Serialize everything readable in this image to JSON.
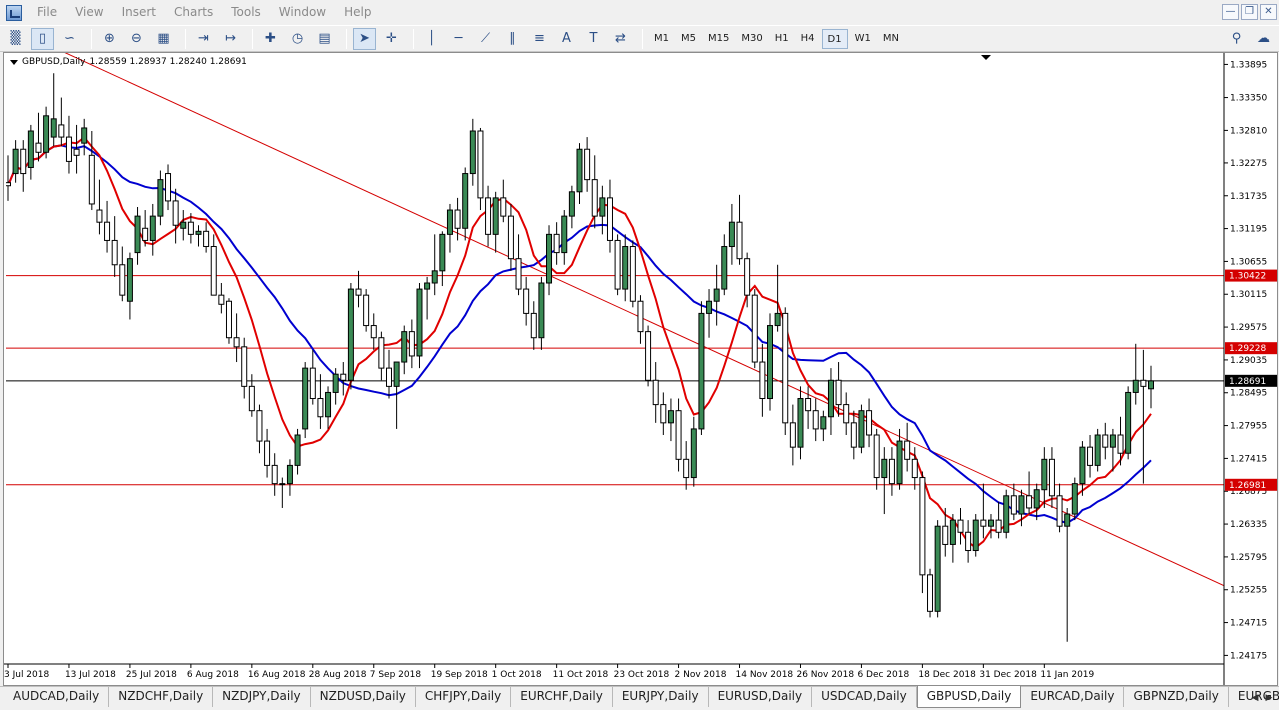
{
  "menu": {
    "items": [
      "File",
      "View",
      "Insert",
      "Charts",
      "Tools",
      "Window",
      "Help"
    ]
  },
  "window_controls": [
    "minimize",
    "restore",
    "close"
  ],
  "toolbar": {
    "icons": [
      "new-chart-icon",
      "bar-chart-icon",
      "candlestick-icon",
      "line-chart-icon",
      "zoom-in-icon",
      "zoom-out-icon",
      "tile-windows-icon",
      "chart-shift-icon",
      "autoscroll-icon",
      "indicators-icon",
      "periods-icon",
      "templates-icon",
      "cursor-icon",
      "crosshair-icon",
      "vertical-line-icon",
      "horizontal-line-icon",
      "trendline-icon",
      "equidistant-channel-icon",
      "fibonacci-icon",
      "text-icon",
      "text-label-icon",
      "arrows-icon",
      "search-icon",
      "community-icon"
    ],
    "timeframes": [
      "M1",
      "M5",
      "M15",
      "M30",
      "H1",
      "H4",
      "D1",
      "W1",
      "MN"
    ],
    "active_timeframe": "D1"
  },
  "chart": {
    "symbol_label": "GBPUSD,Daily",
    "ohlc": "1.28559 1.28937 1.28240 1.28691",
    "colors": {
      "bull": "#3a8a55",
      "bear": "#ffffff",
      "wick": "#000000",
      "ma_fast": "#e00000",
      "ma_slow": "#0000d0",
      "hline": "#d40000",
      "current_price_line": "#000000",
      "trendline": "#d40000"
    }
  },
  "chart_data": {
    "type": "candlestick",
    "symbol": "GBPUSD",
    "timeframe": "Daily",
    "y_ticks": [
      "1.33895",
      "1.33350",
      "1.32810",
      "1.32275",
      "1.31735",
      "1.31195",
      "1.30655",
      "1.30115",
      "1.29575",
      "1.29035",
      "1.28495",
      "1.27955",
      "1.27415",
      "1.26875",
      "1.26335",
      "1.25795",
      "1.25255",
      "1.24715",
      "1.24175"
    ],
    "ylim": [
      1.2405,
      1.3405
    ],
    "x_ticks": [
      "3 Jul 2018",
      "13 Jul 2018",
      "25 Jul 2018",
      "6 Aug 2018",
      "16 Aug 2018",
      "28 Aug 2018",
      "7 Sep 2018",
      "19 Sep 2018",
      "1 Oct 2018",
      "11 Oct 2018",
      "23 Oct 2018",
      "2 Nov 2018",
      "14 Nov 2018",
      "26 Nov 2018",
      "6 Dec 2018",
      "18 Dec 2018",
      "31 Dec 2018",
      "11 Jan 2019"
    ],
    "price_labels": [
      {
        "value": 1.30422,
        "text": "1.30422",
        "style": "red"
      },
      {
        "value": 1.29228,
        "text": "1.29228",
        "style": "red"
      },
      {
        "value": 1.28691,
        "text": "1.28691",
        "style": "black"
      },
      {
        "value": 1.26981,
        "text": "1.26981",
        "style": "red"
      }
    ],
    "horizontal_lines": [
      1.30422,
      1.29228,
      1.26981
    ],
    "current_price": 1.28691,
    "trendline": [
      {
        "bar": 0,
        "price": 1.3452
      },
      {
        "bar": 140,
        "price": 1.2645
      }
    ],
    "bars": [
      [
        1.3195,
        1.324,
        1.3165,
        1.319
      ],
      [
        1.321,
        1.3265,
        1.3195,
        1.325
      ],
      [
        1.325,
        1.3265,
        1.318,
        1.321
      ],
      [
        1.322,
        1.329,
        1.32,
        1.328
      ],
      [
        1.326,
        1.331,
        1.323,
        1.3245
      ],
      [
        1.3245,
        1.332,
        1.3235,
        1.3305
      ],
      [
        1.327,
        1.3375,
        1.3255,
        1.33
      ],
      [
        1.329,
        1.3335,
        1.3255,
        1.327
      ],
      [
        1.327,
        1.3305,
        1.321,
        1.323
      ],
      [
        1.325,
        1.329,
        1.321,
        1.324
      ],
      [
        1.326,
        1.33,
        1.324,
        1.3285
      ],
      [
        1.324,
        1.328,
        1.315,
        1.316
      ],
      [
        1.315,
        1.32,
        1.311,
        1.313
      ],
      [
        1.313,
        1.3165,
        1.308,
        1.31
      ],
      [
        1.31,
        1.314,
        1.304,
        1.306
      ],
      [
        1.306,
        1.309,
        1.3,
        1.301
      ],
      [
        1.3,
        1.308,
        1.297,
        1.307
      ],
      [
        1.308,
        1.3155,
        1.306,
        1.314
      ],
      [
        1.312,
        1.315,
        1.309,
        1.31
      ],
      [
        1.31,
        1.316,
        1.3075,
        1.314
      ],
      [
        1.314,
        1.3215,
        1.3125,
        1.32
      ],
      [
        1.321,
        1.3225,
        1.315,
        1.3165
      ],
      [
        1.3165,
        1.3185,
        1.3095,
        1.3125
      ],
      [
        1.312,
        1.315,
        1.31,
        1.313
      ],
      [
        1.313,
        1.3145,
        1.3095,
        1.311
      ],
      [
        1.311,
        1.3125,
        1.309,
        1.3115
      ],
      [
        1.3115,
        1.313,
        1.308,
        1.309
      ],
      [
        1.309,
        1.311,
        1.301,
        1.301
      ],
      [
        1.301,
        1.303,
        1.298,
        1.2995
      ],
      [
        1.3,
        1.3005,
        1.293,
        1.294
      ],
      [
        1.294,
        1.298,
        1.29,
        1.2925
      ],
      [
        1.2925,
        1.294,
        1.284,
        1.286
      ],
      [
        1.286,
        1.288,
        1.281,
        1.282
      ],
      [
        1.282,
        1.283,
        1.275,
        1.277
      ],
      [
        1.277,
        1.279,
        1.271,
        1.273
      ],
      [
        1.273,
        1.275,
        1.268,
        1.27
      ],
      [
        1.27,
        1.271,
        1.266,
        1.27
      ],
      [
        1.27,
        1.274,
        1.268,
        1.273
      ],
      [
        1.273,
        1.279,
        1.2715,
        1.278
      ],
      [
        1.279,
        1.29,
        1.2775,
        1.289
      ],
      [
        1.289,
        1.292,
        1.283,
        1.284
      ],
      [
        1.284,
        1.288,
        1.279,
        1.281
      ],
      [
        1.281,
        1.286,
        1.279,
        1.285
      ],
      [
        1.285,
        1.289,
        1.283,
        1.288
      ],
      [
        1.288,
        1.29,
        1.2845,
        1.287
      ],
      [
        1.287,
        1.303,
        1.2855,
        1.302
      ],
      [
        1.302,
        1.305,
        1.299,
        1.301
      ],
      [
        1.301,
        1.302,
        1.295,
        1.296
      ],
      [
        1.296,
        1.298,
        1.292,
        1.294
      ],
      [
        1.294,
        1.295,
        1.287,
        1.289
      ],
      [
        1.289,
        1.292,
        1.284,
        1.286
      ],
      [
        1.286,
        1.29,
        1.279,
        1.29
      ],
      [
        1.29,
        1.296,
        1.288,
        1.295
      ],
      [
        1.295,
        1.297,
        1.289,
        1.291
      ],
      [
        1.291,
        1.303,
        1.289,
        1.302
      ],
      [
        1.302,
        1.304,
        1.297,
        1.303
      ],
      [
        1.303,
        1.311,
        1.301,
        1.305
      ],
      [
        1.305,
        1.3115,
        1.3025,
        1.311
      ],
      [
        1.311,
        1.316,
        1.308,
        1.315
      ],
      [
        1.315,
        1.317,
        1.31,
        1.312
      ],
      [
        1.312,
        1.322,
        1.31,
        1.321
      ],
      [
        1.321,
        1.33,
        1.319,
        1.328
      ],
      [
        1.328,
        1.3285,
        1.315,
        1.317
      ],
      [
        1.317,
        1.319,
        1.309,
        1.311
      ],
      [
        1.311,
        1.318,
        1.308,
        1.317
      ],
      [
        1.317,
        1.32,
        1.313,
        1.314
      ],
      [
        1.314,
        1.316,
        1.305,
        1.307
      ],
      [
        1.307,
        1.311,
        1.301,
        1.302
      ],
      [
        1.302,
        1.304,
        1.296,
        1.298
      ],
      [
        1.298,
        1.3,
        1.292,
        1.294
      ],
      [
        1.294,
        1.304,
        1.292,
        1.303
      ],
      [
        1.303,
        1.3125,
        1.301,
        1.311
      ],
      [
        1.311,
        1.313,
        1.306,
        1.308
      ],
      [
        1.308,
        1.315,
        1.306,
        1.314
      ],
      [
        1.314,
        1.319,
        1.312,
        1.318
      ],
      [
        1.318,
        1.326,
        1.316,
        1.325
      ],
      [
        1.325,
        1.327,
        1.318,
        1.32
      ],
      [
        1.32,
        1.324,
        1.312,
        1.314
      ],
      [
        1.314,
        1.319,
        1.311,
        1.317
      ],
      [
        1.317,
        1.32,
        1.308,
        1.31
      ],
      [
        1.31,
        1.311,
        1.301,
        1.302
      ],
      [
        1.302,
        1.311,
        1.3,
        1.309
      ],
      [
        1.309,
        1.31,
        1.299,
        1.3
      ],
      [
        1.3,
        1.301,
        1.293,
        1.295
      ],
      [
        1.295,
        1.296,
        1.286,
        1.287
      ],
      [
        1.287,
        1.29,
        1.28,
        1.283
      ],
      [
        1.283,
        1.285,
        1.278,
        1.28
      ],
      [
        1.28,
        1.284,
        1.277,
        1.282
      ],
      [
        1.282,
        1.284,
        1.272,
        1.274
      ],
      [
        1.274,
        1.277,
        1.269,
        1.271
      ],
      [
        1.271,
        1.281,
        1.2695,
        1.279
      ],
      [
        1.279,
        1.3,
        1.278,
        1.298
      ],
      [
        1.298,
        1.302,
        1.294,
        1.3
      ],
      [
        1.3,
        1.306,
        1.296,
        1.302
      ],
      [
        1.302,
        1.311,
        1.301,
        1.309
      ],
      [
        1.309,
        1.316,
        1.306,
        1.313
      ],
      [
        1.313,
        1.3175,
        1.306,
        1.307
      ],
      [
        1.307,
        1.308,
        1.299,
        1.301
      ],
      [
        1.301,
        1.302,
        1.289,
        1.29
      ],
      [
        1.29,
        1.293,
        1.281,
        1.284
      ],
      [
        1.284,
        1.298,
        1.282,
        1.296
      ],
      [
        1.296,
        1.306,
        1.295,
        1.298
      ],
      [
        1.298,
        1.299,
        1.278,
        1.28
      ],
      [
        1.28,
        1.283,
        1.273,
        1.276
      ],
      [
        1.276,
        1.286,
        1.274,
        1.284
      ],
      [
        1.284,
        1.286,
        1.279,
        1.282
      ],
      [
        1.282,
        1.284,
        1.277,
        1.279
      ],
      [
        1.279,
        1.282,
        1.277,
        1.281
      ],
      [
        1.281,
        1.289,
        1.278,
        1.287
      ],
      [
        1.287,
        1.29,
        1.281,
        1.283
      ],
      [
        1.283,
        1.285,
        1.278,
        1.28
      ],
      [
        1.28,
        1.282,
        1.274,
        1.276
      ],
      [
        1.276,
        1.283,
        1.275,
        1.282
      ],
      [
        1.282,
        1.284,
        1.276,
        1.278
      ],
      [
        1.278,
        1.279,
        1.269,
        1.271
      ],
      [
        1.271,
        1.276,
        1.265,
        1.274
      ],
      [
        1.274,
        1.276,
        1.268,
        1.27
      ],
      [
        1.27,
        1.279,
        1.269,
        1.277
      ],
      [
        1.277,
        1.28,
        1.272,
        1.274
      ],
      [
        1.274,
        1.276,
        1.269,
        1.271
      ],
      [
        1.271,
        1.272,
        1.252,
        1.255
      ],
      [
        1.255,
        1.256,
        1.248,
        1.249
      ],
      [
        1.249,
        1.264,
        1.248,
        1.263
      ],
      [
        1.263,
        1.266,
        1.258,
        1.26
      ],
      [
        1.26,
        1.265,
        1.257,
        1.264
      ],
      [
        1.264,
        1.266,
        1.26,
        1.262
      ],
      [
        1.262,
        1.264,
        1.257,
        1.259
      ],
      [
        1.259,
        1.265,
        1.258,
        1.264
      ],
      [
        1.264,
        1.27,
        1.261,
        1.263
      ],
      [
        1.263,
        1.265,
        1.261,
        1.264
      ],
      [
        1.264,
        1.267,
        1.261,
        1.262
      ],
      [
        1.262,
        1.269,
        1.261,
        1.268
      ],
      [
        1.268,
        1.27,
        1.264,
        1.265
      ],
      [
        1.265,
        1.269,
        1.263,
        1.268
      ],
      [
        1.268,
        1.272,
        1.265,
        1.266
      ],
      [
        1.266,
        1.27,
        1.264,
        1.269
      ],
      [
        1.269,
        1.276,
        1.266,
        1.274
      ],
      [
        1.274,
        1.276,
        1.266,
        1.268
      ],
      [
        1.268,
        1.27,
        1.262,
        1.263
      ],
      [
        1.263,
        1.266,
        1.244,
        1.265
      ],
      [
        1.265,
        1.271,
        1.264,
        1.27
      ],
      [
        1.27,
        1.277,
        1.268,
        1.276
      ],
      [
        1.276,
        1.278,
        1.271,
        1.273
      ],
      [
        1.273,
        1.279,
        1.272,
        1.278
      ],
      [
        1.278,
        1.28,
        1.274,
        1.276
      ],
      [
        1.276,
        1.279,
        1.272,
        1.278
      ],
      [
        1.278,
        1.281,
        1.273,
        1.275
      ],
      [
        1.275,
        1.286,
        1.274,
        1.285
      ],
      [
        1.285,
        1.293,
        1.283,
        1.287
      ],
      [
        1.287,
        1.292,
        1.27,
        1.286
      ],
      [
        1.2856,
        1.2894,
        1.2824,
        1.2869
      ]
    ]
  },
  "tabs": [
    "AUDCAD,Daily",
    "NZDCHF,Daily",
    "NZDJPY,Daily",
    "NZDUSD,Daily",
    "CHFJPY,Daily",
    "EURCHF,Daily",
    "EURJPY,Daily",
    "EURUSD,Daily",
    "USDCAD,Daily",
    "GBPUSD,Daily",
    "EURCAD,Daily",
    "GBPNZD,Daily",
    "EURGBP,Daily"
  ],
  "active_tab": "GBPUSD,Daily"
}
